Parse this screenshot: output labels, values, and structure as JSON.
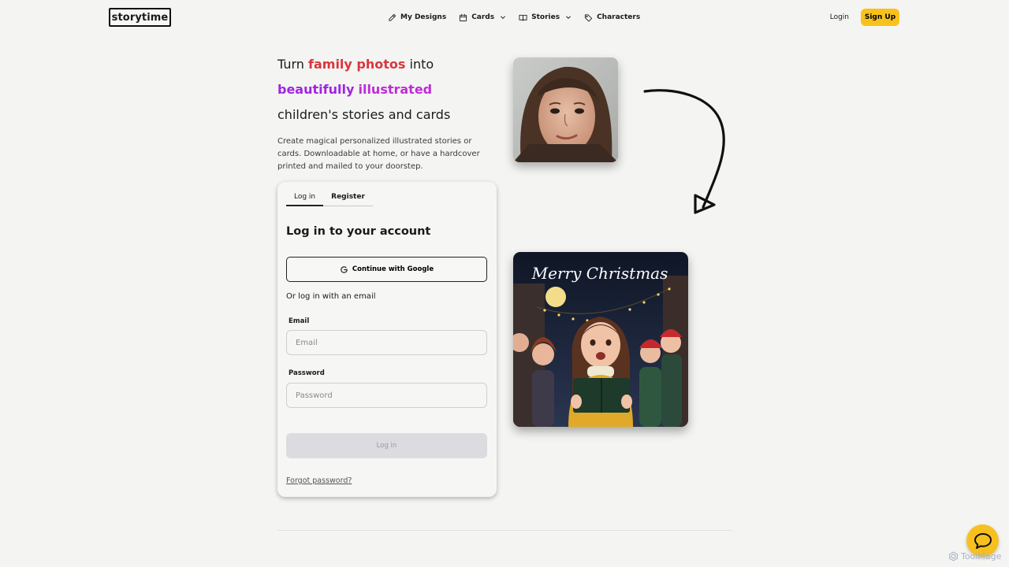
{
  "header": {
    "logo": "storytime",
    "nav": [
      {
        "label": "My Designs",
        "icon": "pencil-icon"
      },
      {
        "label": "Cards",
        "icon": "calendar-icon",
        "dropdown": true
      },
      {
        "label": "Stories",
        "icon": "book-icon",
        "dropdown": true
      },
      {
        "label": "Characters",
        "icon": "tag-icon"
      }
    ],
    "login": "Login",
    "signup": "Sign Up"
  },
  "hero": {
    "t1": "Turn ",
    "t2": "family photos",
    "t3": " into ",
    "t4": "beautifully",
    "t5": "illustrated",
    "t6": " children's stories and cards",
    "subtitle": "Create magical personalized illustrated stories or cards. Downloadable at home, or have a hardcover printed and mailed to your doorstep."
  },
  "auth": {
    "tabs": [
      "Log in",
      "Register"
    ],
    "title": "Log in to your account",
    "google_button": "Continue with Google",
    "or_email": "Or log in with an email",
    "email_label": "Email",
    "email_placeholder": "Email",
    "password_label": "Password",
    "password_placeholder": "Password",
    "submit": "Log in",
    "forgot": "Forgot password?"
  },
  "card_preview": {
    "greeting": "Merry Christmas"
  },
  "watermark": "ToolMage",
  "colors": {
    "accent_yellow": "#f8c21a",
    "highlight_red": "#d9363e",
    "highlight_purple": "#a124e0",
    "highlight_magenta": "#bf2bd6"
  }
}
